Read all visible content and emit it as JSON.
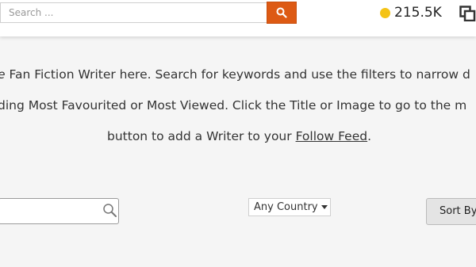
{
  "header": {
    "search_placeholder": "Search ...",
    "coin_count": "215.5K",
    "accent_color": "#dd5a14",
    "coin_color": "#f4c316"
  },
  "intro": {
    "line1_italic": "e",
    "line1_rest": " Fan Fiction Writer here. Search for keywords and use the filters to narrow d",
    "line2": "ding Most Favourited or Most Viewed. Click the Title or Image to go to the m",
    "line3_before": "button to add a Writer to your ",
    "line3_link": "Follow Feed",
    "line3_after": "."
  },
  "filters": {
    "country_selected": "Any Country",
    "sort_label": "Sort By"
  },
  "icons": {
    "search_button": "search-icon",
    "coin": "coin-icon",
    "copy": "copy-icon",
    "magnifier": "magnifier-icon",
    "caret": "chevron-down-icon"
  }
}
